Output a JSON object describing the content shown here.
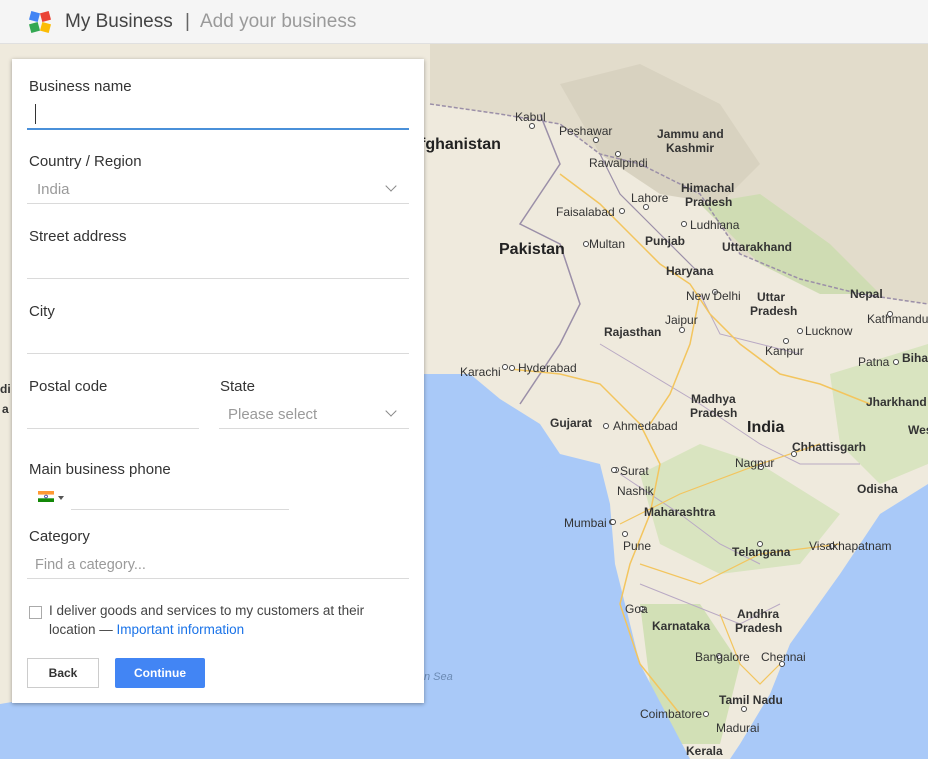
{
  "header": {
    "logo": "google-my-business-logo",
    "brand": "My Business",
    "separator": "|",
    "subtitle": "Add your business"
  },
  "form": {
    "business_name_label": "Business name",
    "business_name_value": "",
    "country_label": "Country / Region",
    "country_value": "India",
    "street_label": "Street address",
    "city_label": "City",
    "postal_label": "Postal code",
    "state_label": "State",
    "state_placeholder": "Please select",
    "phone_label": "Main business phone",
    "phone_flag": "india-flag-icon",
    "category_label": "Category",
    "category_placeholder": "Find a category...",
    "delivery_text": "I deliver goods and services to my customers at their location — ",
    "delivery_link": "Important information",
    "back_label": "Back",
    "continue_label": "Continue"
  },
  "map": {
    "labels": {
      "afghanistan": "fghanistan",
      "pakistan": "Pakistan",
      "india": "India",
      "nepal": "Nepal",
      "kabul": "Kabul",
      "peshawar": "Peshawar",
      "jammu": "Jammu and",
      "kashmir": "Kashmir",
      "rawalpindi": "Rawalpindi",
      "himachal": "Himachal",
      "pradesh_hp": "Pradesh",
      "lahore": "Lahore",
      "faisalabad": "Faisalabad",
      "ludhiana": "Ludhiana",
      "punjab": "Punjab",
      "multan": "Multan",
      "uttarakhand": "Uttarakhand",
      "haryana": "Haryana",
      "new_delhi": "New Delhi",
      "uttar": "Uttar",
      "pradesh_up": "Pradesh",
      "kathmandu": "Kathmandu",
      "rajasthan": "Rajasthan",
      "jaipur": "Jaipur",
      "lucknow": "Lucknow",
      "patna": "Patna",
      "bihar": "Biha",
      "kanpur": "Kanpur",
      "karachi": "Karachi",
      "hyderabad": "Hyderabad",
      "madhya": "Madhya",
      "pradesh_mp": "Pradesh",
      "jharkhand": "Jharkhand",
      "west": "Wes",
      "gujarat": "Gujarat",
      "ahmedabad": "Ahmedabad",
      "chhattisgarh": "Chhattisgarh",
      "nagpur": "Nagpur",
      "surat": "Surat",
      "odisha": "Odisha",
      "nashik": "Nashik",
      "maharashtra": "Maharashtra",
      "mumbai": "Mumbai",
      "pune": "Pune",
      "telangana": "Telangana",
      "visakhapatnam": "Visakhapatnam",
      "goa": "Goa",
      "karnataka": "Karnataka",
      "andhra": "Andhra",
      "pradesh_ap": "Pradesh",
      "bangalore": "Bangalore",
      "chennai": "Chennai",
      "tamil_nadu": "Tamil Nadu",
      "coimbatore": "Coimbatore",
      "madurai": "Madurai",
      "kerala": "Kerala",
      "sea": "n Sea",
      "edge_di": "di",
      "edge_a": "a"
    },
    "colors": {
      "land": "#efeadd",
      "land_green": "#d9e4c0",
      "water": "#a9c9f8",
      "border": "#9b8fa8",
      "road": "#f3c55e"
    }
  }
}
